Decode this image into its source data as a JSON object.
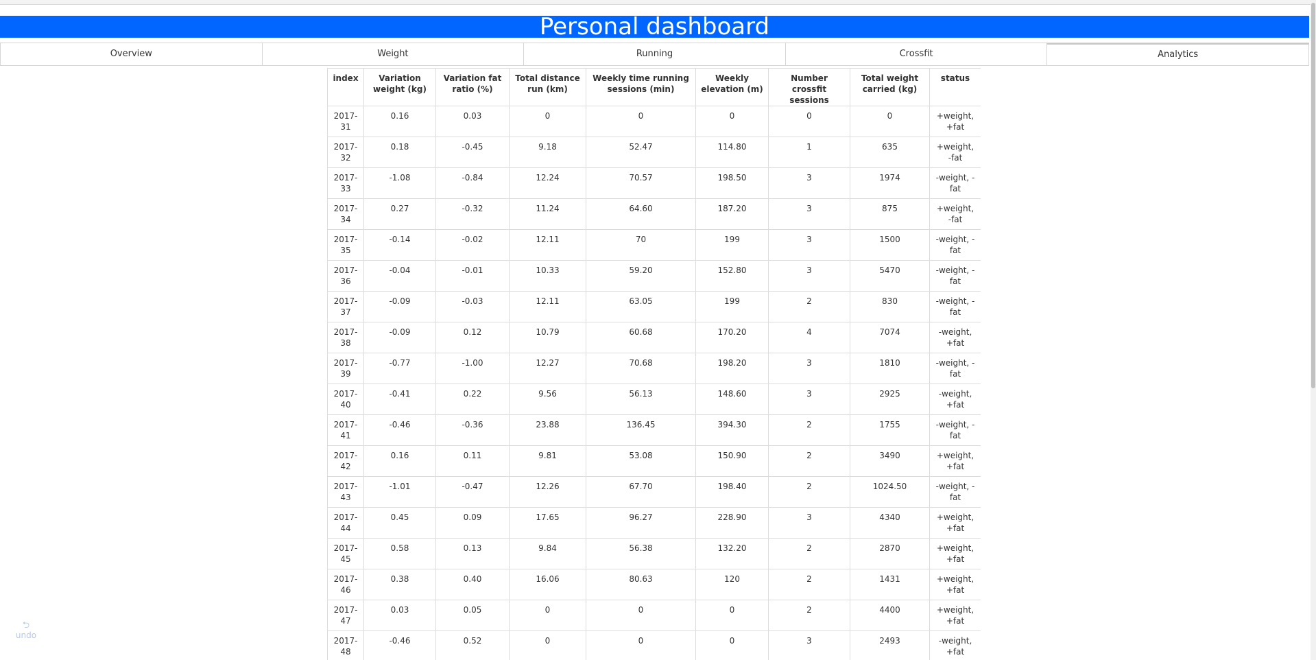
{
  "header": {
    "title": "Personal dashboard"
  },
  "tabs": [
    {
      "label": "Overview"
    },
    {
      "label": "Weight"
    },
    {
      "label": "Running"
    },
    {
      "label": "Crossfit"
    },
    {
      "label": "Analytics",
      "active": true
    }
  ],
  "table": {
    "columns": [
      "index",
      "Variation weight (kg)",
      "Variation fat ratio (%)",
      "Total distance run (km)",
      "Weekly time running sessions (min)",
      "Weekly elevation (m)",
      "Number crossfit sessions",
      "Total weight carried (kg)",
      "status"
    ],
    "rows": [
      [
        "2017-31",
        "0.16",
        "0.03",
        "0",
        "0",
        "0",
        "0",
        "0",
        "+weight, +fat"
      ],
      [
        "2017-32",
        "0.18",
        "-0.45",
        "9.18",
        "52.47",
        "114.80",
        "1",
        "635",
        "+weight, -fat"
      ],
      [
        "2017-33",
        "-1.08",
        "-0.84",
        "12.24",
        "70.57",
        "198.50",
        "3",
        "1974",
        "-weight, -fat"
      ],
      [
        "2017-34",
        "0.27",
        "-0.32",
        "11.24",
        "64.60",
        "187.20",
        "3",
        "875",
        "+weight, -fat"
      ],
      [
        "2017-35",
        "-0.14",
        "-0.02",
        "12.11",
        "70",
        "199",
        "3",
        "1500",
        "-weight, -fat"
      ],
      [
        "2017-36",
        "-0.04",
        "-0.01",
        "10.33",
        "59.20",
        "152.80",
        "3",
        "5470",
        "-weight, -fat"
      ],
      [
        "2017-37",
        "-0.09",
        "-0.03",
        "12.11",
        "63.05",
        "199",
        "2",
        "830",
        "-weight, -fat"
      ],
      [
        "2017-38",
        "-0.09",
        "0.12",
        "10.79",
        "60.68",
        "170.20",
        "4",
        "7074",
        "-weight, +fat"
      ],
      [
        "2017-39",
        "-0.77",
        "-1.00",
        "12.27",
        "70.68",
        "198.20",
        "3",
        "1810",
        "-weight, -fat"
      ],
      [
        "2017-40",
        "-0.41",
        "0.22",
        "9.56",
        "56.13",
        "148.60",
        "3",
        "2925",
        "-weight, +fat"
      ],
      [
        "2017-41",
        "-0.46",
        "-0.36",
        "23.88",
        "136.45",
        "394.30",
        "2",
        "1755",
        "-weight, -fat"
      ],
      [
        "2017-42",
        "0.16",
        "0.11",
        "9.81",
        "53.08",
        "150.90",
        "2",
        "3490",
        "+weight, +fat"
      ],
      [
        "2017-43",
        "-1.01",
        "-0.47",
        "12.26",
        "67.70",
        "198.40",
        "2",
        "1024.50",
        "-weight, -fat"
      ],
      [
        "2017-44",
        "0.45",
        "0.09",
        "17.65",
        "96.27",
        "228.90",
        "3",
        "4340",
        "+weight, +fat"
      ],
      [
        "2017-45",
        "0.58",
        "0.13",
        "9.84",
        "56.38",
        "132.20",
        "2",
        "2870",
        "+weight, +fat"
      ],
      [
        "2017-46",
        "0.38",
        "0.40",
        "16.06",
        "80.63",
        "120",
        "2",
        "1431",
        "+weight, +fat"
      ],
      [
        "2017-47",
        "0.03",
        "0.05",
        "0",
        "0",
        "0",
        "2",
        "4400",
        "+weight, +fat"
      ],
      [
        "2017-48",
        "-0.46",
        "0.52",
        "0",
        "0",
        "0",
        "3",
        "2493",
        "-weight, +fat"
      ],
      [
        "",
        "",
        "",
        "",
        "",
        "",
        "",
        "",
        ""
      ]
    ]
  },
  "undo": {
    "label": "undo",
    "icon": "undo-icon"
  },
  "colors": {
    "header_bg": "#0066ff",
    "header_text": "#ffffff",
    "border": "#dcdcdc"
  }
}
